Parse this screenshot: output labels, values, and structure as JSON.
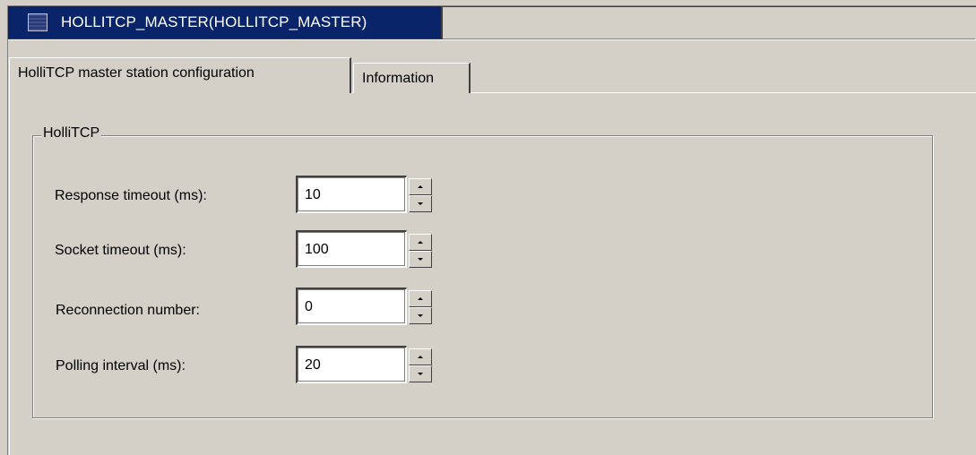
{
  "document_tab": {
    "title": "HOLLITCP_MASTER(HOLLITCP_MASTER)",
    "icon": "module-icon"
  },
  "tabs": [
    {
      "label": "HolliTCP master station configuration",
      "active": true
    },
    {
      "label": "Information",
      "active": false
    }
  ],
  "group": {
    "title": "HolliTCP"
  },
  "fields": [
    {
      "label": "Response timeout (ms):",
      "value": "10"
    },
    {
      "label": "Socket timeout (ms):",
      "value": "100"
    },
    {
      "label": "Reconnection number:",
      "value": "0"
    },
    {
      "label": "Polling interval (ms):",
      "value": "20"
    }
  ],
  "colors": {
    "title_bar": "#0a246a",
    "panel": "#d4d0c8",
    "input_bg": "#ffffff"
  }
}
